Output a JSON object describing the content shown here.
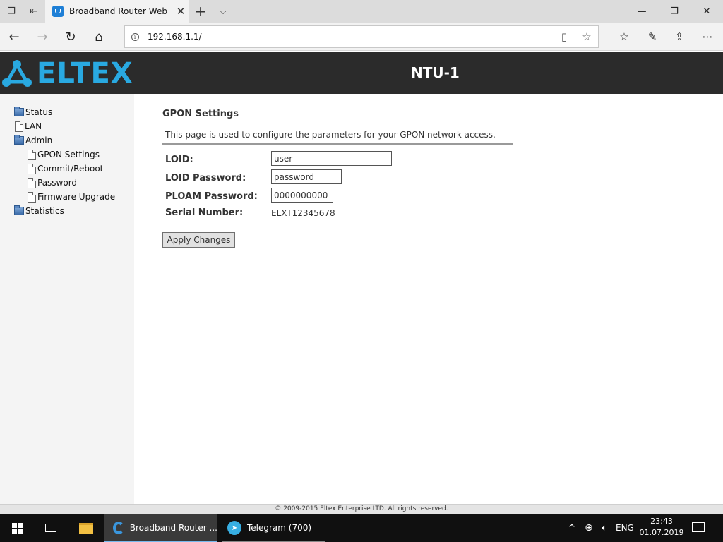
{
  "browser": {
    "tab_title": "Broadband Router Web",
    "address_url": "192.168.1.1/"
  },
  "router": {
    "brand": "ELTEX",
    "model": "NTU-1",
    "nav": [
      {
        "label": "Status",
        "type": "folder",
        "level": 0
      },
      {
        "label": "LAN",
        "type": "page",
        "level": 0
      },
      {
        "label": "Admin",
        "type": "folder",
        "level": 0
      },
      {
        "label": "GPON Settings",
        "type": "page",
        "level": 1
      },
      {
        "label": "Commit/Reboot",
        "type": "page",
        "level": 1
      },
      {
        "label": "Password",
        "type": "page",
        "level": 1
      },
      {
        "label": "Firmware Upgrade",
        "type": "page",
        "level": 1
      },
      {
        "label": "Statistics",
        "type": "folder",
        "level": 0
      }
    ],
    "section_title": "GPON Settings",
    "section_desc": "This page is used to configure the parameters for your GPON network access.",
    "fields": {
      "loid": {
        "label": "LOID:",
        "value": "user"
      },
      "loid_password": {
        "label": "LOID Password:",
        "value": "password"
      },
      "ploam_password": {
        "label": "PLOAM Password:",
        "value": "0000000000"
      },
      "serial_number": {
        "label": "Serial Number:",
        "value": "ELXT12345678"
      }
    },
    "apply_label": "Apply Changes",
    "footer": "© 2009-2015 Eltex Enterprise LTD. All rights reserved."
  },
  "taskbar": {
    "apps": [
      {
        "label": "Broadband Router ...",
        "active": true
      },
      {
        "label": "Telegram (700)",
        "active": false
      }
    ],
    "language": "ENG",
    "time": "23:43",
    "date": "01.07.2019"
  },
  "colors": {
    "brand_blue": "#29a9e1",
    "header_bg": "#2b2b2b",
    "taskbar_bg": "#101010"
  }
}
